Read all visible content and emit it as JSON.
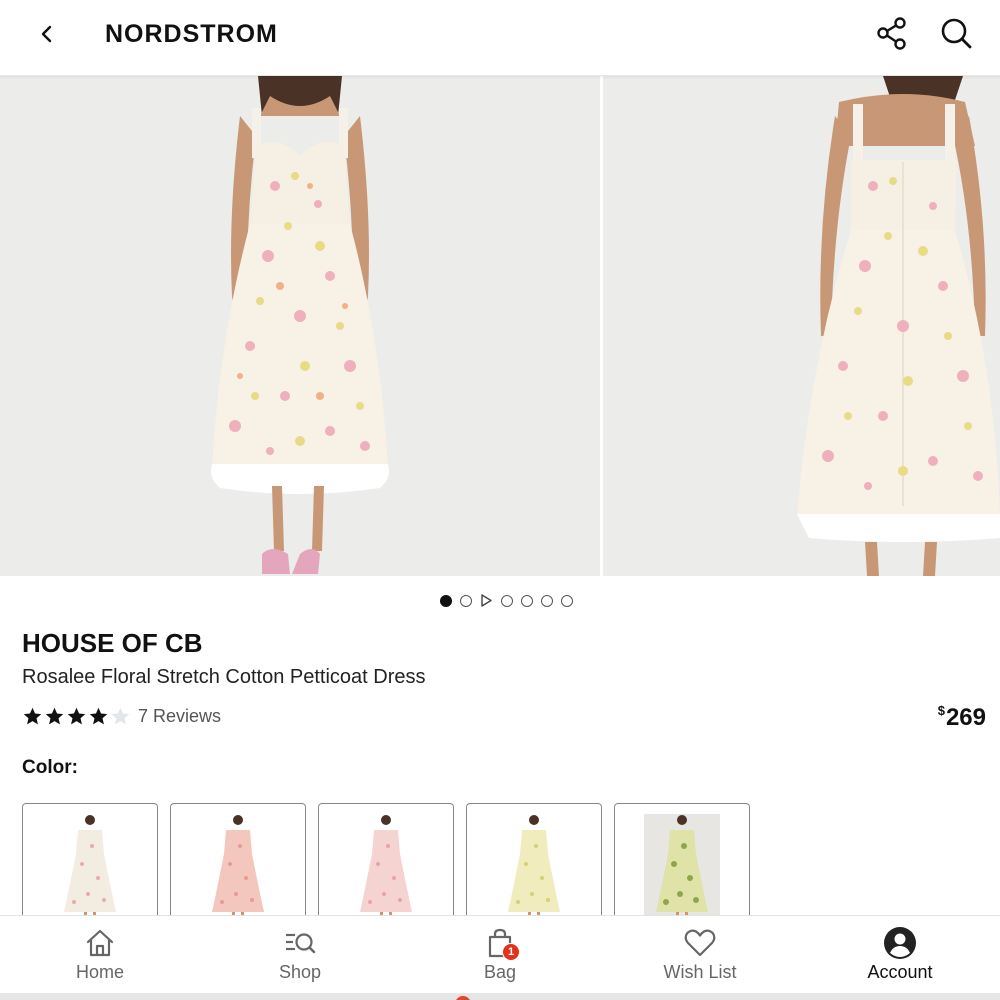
{
  "header": {
    "logo": "NORDSTROM",
    "back_icon": "chevron-left-icon",
    "share_icon": "share-icon",
    "search_icon": "search-icon"
  },
  "gallery": {
    "images": [
      "front-view-photo",
      "back-view-photo"
    ],
    "dots_total": 7,
    "active_dot": 0,
    "video_dot_index": 2
  },
  "product": {
    "brand": "HOUSE OF CB",
    "name": "Rosalee Floral Stretch Cotton Petticoat Dress",
    "rating": 4,
    "rating_max": 5,
    "reviews_label": "7 Reviews",
    "price_currency": "$",
    "price_value": "269",
    "color_label": "Color:"
  },
  "swatches": [
    {
      "name": "ivory-floral",
      "dress_color": "#f3ece0",
      "accent": "#e9a9b4",
      "bg": "#ffffff"
    },
    {
      "name": "pink-floral",
      "dress_color": "#f3c7bd",
      "accent": "#e79b8f",
      "bg": "#ffffff"
    },
    {
      "name": "blush-floral",
      "dress_color": "#f5d3d1",
      "accent": "#eaa2aa",
      "bg": "#ffffff"
    },
    {
      "name": "yellow-floral",
      "dress_color": "#f1ecbe",
      "accent": "#d9cf77",
      "bg": "#ffffff"
    },
    {
      "name": "green-floral",
      "dress_color": "#dfe3a8",
      "accent": "#8fa54b",
      "bg": "#e8e6e2"
    }
  ],
  "bottom_nav": [
    {
      "label": "Home",
      "icon": "home-icon"
    },
    {
      "label": "Shop",
      "icon": "shop-search-icon"
    },
    {
      "label": "Bag",
      "icon": "bag-icon",
      "badge": "1"
    },
    {
      "label": "Wish List",
      "icon": "heart-icon"
    },
    {
      "label": "Account",
      "icon": "account-icon",
      "active": true
    }
  ],
  "colors": {
    "badge": "#e0321c",
    "text": "#111111",
    "muted": "#666666",
    "photo_bg": "#ececeb"
  }
}
